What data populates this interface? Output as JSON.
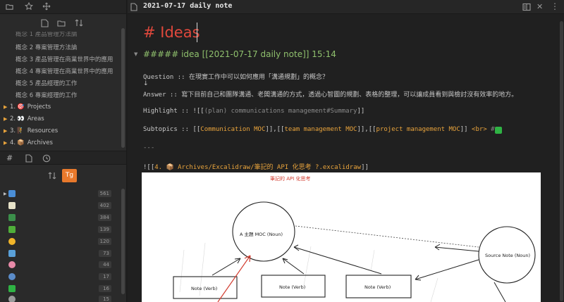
{
  "sidebar": {
    "file_tree_truncated": [
      "概念 2 專案管理方法論",
      "概念 3 產品管理在商業世界中的應用",
      "概念 4 專案管理在商業世界中的應用",
      "概念 5 產品經理的工作",
      "概念 6 專案經理的工作"
    ],
    "file_tree_top": "概念 1 產品管理方法論",
    "folders": [
      {
        "index": "1.",
        "emoji": "🎯",
        "name": "Projects"
      },
      {
        "index": "2.",
        "emoji": "👀",
        "name": "Areas"
      },
      {
        "index": "3.",
        "emoji": "🧗",
        "name": "Resources"
      },
      {
        "index": "4.",
        "emoji": "📦",
        "name": "Archives"
      }
    ],
    "tag_counts": [
      "561",
      "402",
      "384",
      "139",
      "120",
      "73",
      "44",
      "17",
      "16",
      "15"
    ],
    "tag_sort_badge": "Tg"
  },
  "editor": {
    "tab_title": "2021-07-17 daily note",
    "heading": "# Ideas",
    "subheading": "##### idea [[2021-07-17 daily note]] 15:14",
    "question_label": "Question :: ",
    "question_text": "在現實工作中可以如何應用「溝通規劃」的概念？",
    "arrow": "↓",
    "answer_label": "Answer :: ",
    "answer_text": "寫下目前自己和團隊溝通、老闆溝通的方式，透過心智圖的規劃、表格的整理，可以讓成員看到與檢討沒有效率的地方。",
    "highlight_label": "Highlight :: ![[",
    "highlight_link": "(plan) communications management#Summary",
    "highlight_close": "]]",
    "subtopics_label": "Subtopics :: [[",
    "subtopics_link1": "Communication MOC",
    "subtopics_sep1": "]],[[",
    "subtopics_link2": "team management MOC",
    "subtopics_sep2": "]],[[",
    "subtopics_link3": "project management MOC",
    "subtopics_close": "]]",
    "subtopics_br": "<br>",
    "subtopics_hash": "#",
    "hr": "---",
    "embed_prefix": "![[",
    "embed_path": "4. 📦 Archives/Excalidraw/筆記的 API 化思考 ?.excalidraw",
    "embed_close": "]]"
  },
  "drawing": {
    "title": "筆記的 API 化思考",
    "center_node": "A 主題 MOC (Noun)",
    "source_node": "Source Note (Noun)",
    "note_boxes": [
      "Note (Verb)",
      "Note (Verb)",
      "Note (Verb)"
    ]
  },
  "colors": {
    "accent": "#e8a33c",
    "heading": "#e0483c",
    "subheading": "#8fc06d",
    "link": "#e07a36"
  }
}
